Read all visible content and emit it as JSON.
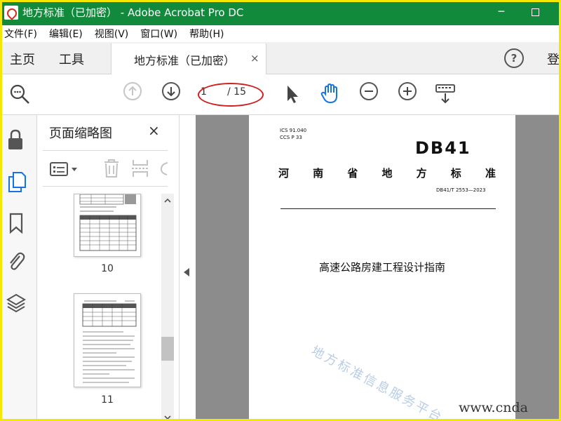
{
  "window": {
    "title": "地方标准（已加密） - Adobe Acrobat Pro DC",
    "minimize_glyph": "─",
    "icon_name": "acrobat-icon",
    "title_bar_color": "#128a3c"
  },
  "menubar": {
    "items": [
      "文件(F)",
      "编辑(E)",
      "视图(V)",
      "窗口(W)",
      "帮助(H)"
    ]
  },
  "tabs": {
    "home": "主页",
    "tools": "工具",
    "document": "地方标准（已加密）",
    "close_glyph": "×",
    "help_glyph": "?",
    "signin": "登"
  },
  "toolbar": {
    "current_page": "1",
    "total_pages": "/ 15",
    "highlight_color": "#d11f1f",
    "icons": [
      "zoom-search-icon",
      "page-up-icon",
      "page-down-icon",
      "select-arrow-icon",
      "hand-tool-icon",
      "zoom-out-icon",
      "zoom-in-icon",
      "keyboard-scroll-icon"
    ]
  },
  "rail": {
    "icons": [
      "lock-icon",
      "pages-icon",
      "bookmark-icon",
      "attachment-icon",
      "layers-icon"
    ],
    "accent_color": "#1473e6"
  },
  "thumbnail_panel": {
    "title": "页面缩略图",
    "close_glyph": "×",
    "tool_icons": [
      "thumbnail-options-icon",
      "delete-page-icon",
      "insert-page-icon",
      "rotate-page-icon"
    ],
    "pages": [
      {
        "label": "10"
      },
      {
        "label": "11"
      }
    ]
  },
  "document": {
    "ics": "ICS  91.040",
    "ccs": "CCS  P 33",
    "standard_mark": "DB41",
    "province_chars": [
      "河",
      "南",
      "省",
      "地",
      "方",
      "标",
      "准"
    ],
    "standard_code": "DB41/T 2553—2023",
    "title": "高速公路房建工程设计指南",
    "watermark": "地方标准信息服务平台",
    "site_watermark": "www.cnda"
  }
}
